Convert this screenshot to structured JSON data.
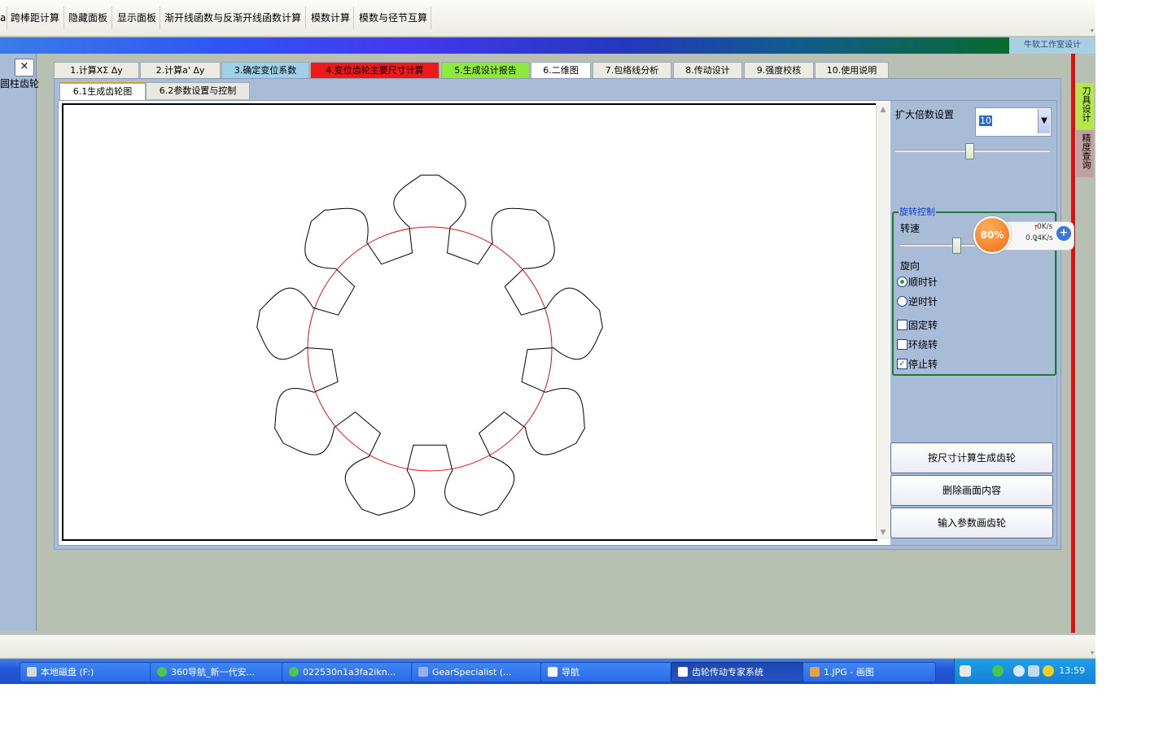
{
  "toolbar": {
    "items": [
      "跨棒距计算",
      "隐藏面板",
      "显示面板",
      "渐开线函数与反渐开线函数计算",
      "模数计算",
      "模数与径节互算"
    ],
    "edge_fragment": "a"
  },
  "brand": "牛软工作室设计",
  "left_panel": {
    "close": "×",
    "label": "圆柱齿轮"
  },
  "right_tabs": [
    "刀具设计",
    "精度查询"
  ],
  "main_tabs": [
    {
      "label": "1.计算XΣ  Δy",
      "color": "#ecebe2"
    },
    {
      "label": "2.计算a' Δy",
      "color": "#ecebe2"
    },
    {
      "label": "3.确定变位系数",
      "color": "#9ed0e8"
    },
    {
      "label": "4.变位齿轮主要尺寸计算",
      "color": "#ee1a1a"
    },
    {
      "label": "5.生成设计报告",
      "color": "#8eea3a"
    },
    {
      "label": "6.二维图",
      "color": "#ffffff"
    },
    {
      "label": "7.包络线分析",
      "color": "#ecebe2"
    },
    {
      "label": "8.传动设计",
      "color": "#ecebe2"
    },
    {
      "label": "9.强度校核",
      "color": "#ecebe2"
    },
    {
      "label": "10.使用说明",
      "color": "#ecebe2"
    }
  ],
  "sub_tabs": [
    "6.1生成齿轮图",
    "6.2参数设置与控制"
  ],
  "gear": {
    "teeth": 9,
    "circle_color": "#dd1111",
    "outline_color": "#000000"
  },
  "controls": {
    "zoom_label": "扩大倍数设置",
    "zoom_value": "10",
    "zoom_slider": 0.48,
    "rotation": {
      "title": "旋转控制",
      "speed_label": "转速",
      "speed_slider": 0.75,
      "direction_label": "旋向",
      "clockwise": "顺时针",
      "counterclockwise": "逆时针",
      "fixed": "固定转",
      "orbit": "环绕转",
      "stop": "停止转",
      "clockwise_selected": true,
      "fixed_checked": false,
      "orbit_checked": false,
      "stop_checked": true
    },
    "buttons": [
      "按尺寸计算生成齿轮",
      "删除画面内容",
      "输入参数画齿轮"
    ]
  },
  "speed_widget": {
    "percent": "80%",
    "up": "0K/s",
    "down": "0.04K/s"
  },
  "taskbar": {
    "tasks": [
      {
        "label": "本地磁盘 (F:)",
        "active": false
      },
      {
        "label": "360导航_新一代安...",
        "active": false
      },
      {
        "label": "022530n1a3fa2ikn...",
        "active": false
      },
      {
        "label": "GearSpecialist (...",
        "active": false
      },
      {
        "label": "导航",
        "active": false
      },
      {
        "label": "齿轮传动专家系统",
        "active": true
      },
      {
        "label": "1.JPG - 画图",
        "active": false
      }
    ],
    "clock": "13:59"
  }
}
